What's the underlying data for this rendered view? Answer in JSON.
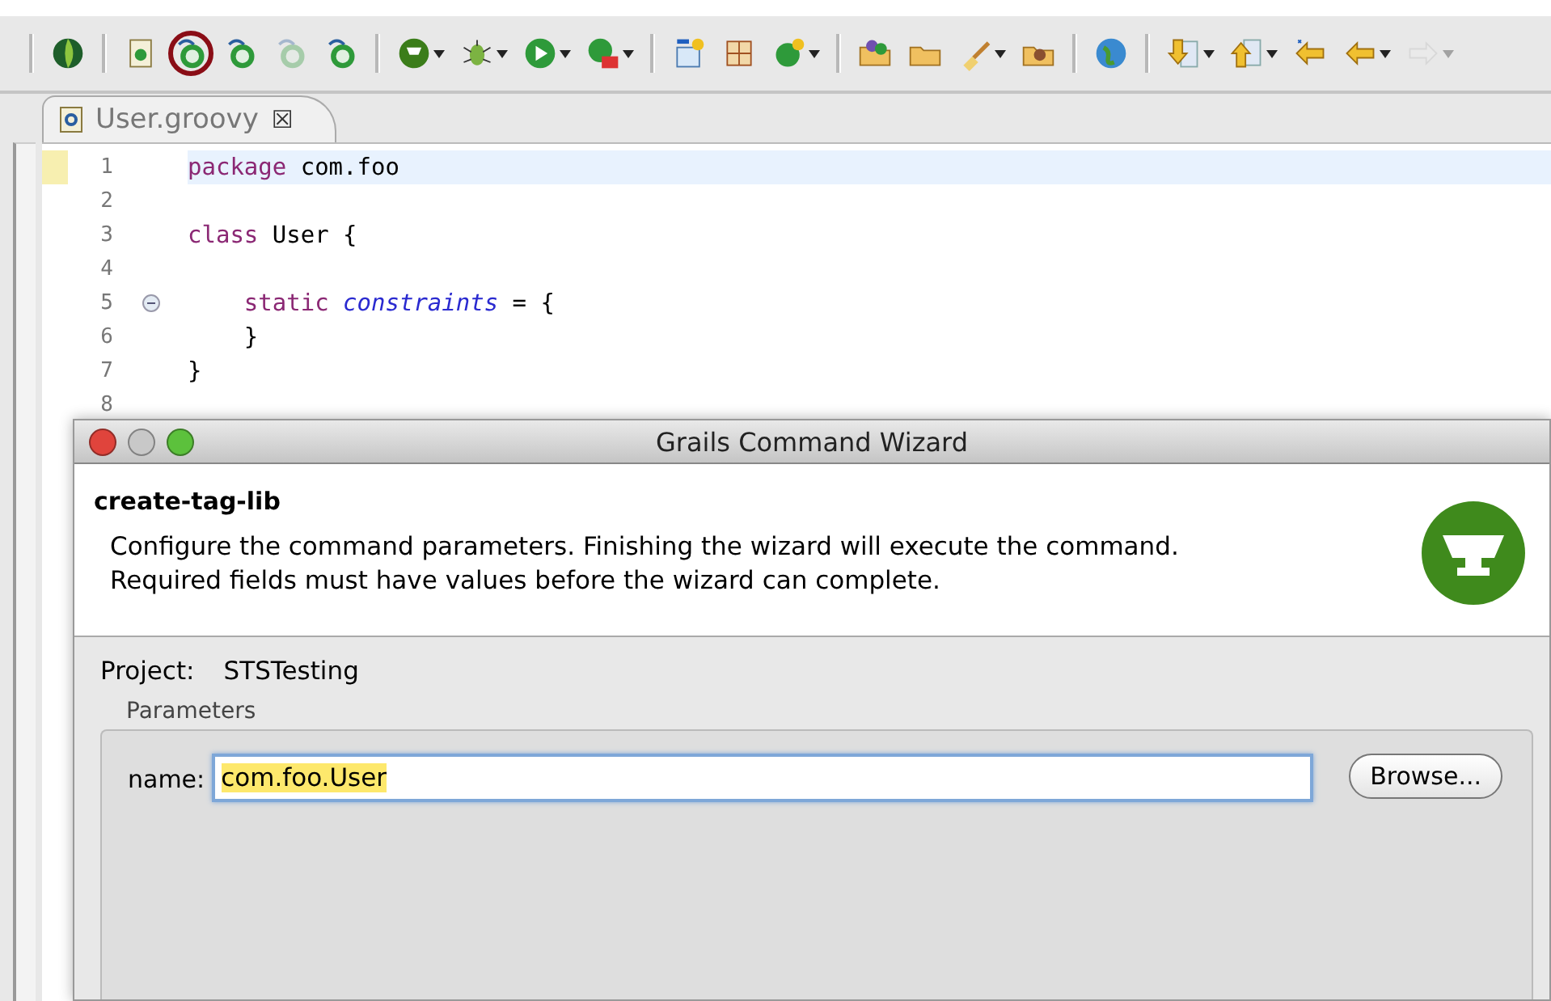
{
  "toolbar": [
    [
      {
        "dropdown": false,
        "circled": false,
        "disabled": false
      }
    ],
    [
      {
        "dropdown": false,
        "circled": false,
        "disabled": false
      },
      {
        "dropdown": false,
        "circled": true,
        "disabled": false
      },
      {
        "dropdown": false,
        "circled": false,
        "disabled": false
      },
      {
        "dropdown": false,
        "circled": false,
        "disabled": true
      },
      {
        "dropdown": false,
        "circled": false,
        "disabled": false
      }
    ],
    [
      {
        "dropdown": true,
        "circled": false,
        "disabled": false
      },
      {
        "dropdown": true,
        "circled": false,
        "disabled": false
      },
      {
        "dropdown": true,
        "circled": false,
        "disabled": false
      },
      {
        "dropdown": true,
        "circled": false,
        "disabled": false
      }
    ],
    [
      {
        "dropdown": false,
        "circled": false,
        "disabled": false
      },
      {
        "dropdown": false,
        "circled": false,
        "disabled": false
      },
      {
        "dropdown": true,
        "circled": false,
        "disabled": false
      }
    ],
    [
      {
        "dropdown": false,
        "circled": false,
        "disabled": false
      },
      {
        "dropdown": false,
        "circled": false,
        "disabled": false
      },
      {
        "dropdown": true,
        "circled": false,
        "disabled": false
      },
      {
        "dropdown": false,
        "circled": false,
        "disabled": false
      }
    ],
    [
      {
        "dropdown": false,
        "circled": false,
        "disabled": false
      }
    ],
    [
      {
        "dropdown": true,
        "circled": false,
        "disabled": false
      },
      {
        "dropdown": true,
        "circled": false,
        "disabled": false
      },
      {
        "dropdown": false,
        "circled": false,
        "disabled": false
      },
      {
        "dropdown": true,
        "circled": false,
        "disabled": false
      },
      {
        "dropdown": true,
        "circled": false,
        "disabled": true
      }
    ]
  ],
  "editor_tab": {
    "label": "User.groovy",
    "close": "☒",
    "selected": true
  },
  "code_lines": [
    {
      "number": "1",
      "current": true,
      "fold_marker": false,
      "tokens": [
        {
          "kind": "keyword",
          "text": "package"
        },
        {
          "kind": "plain",
          "text": " com.foo"
        }
      ]
    },
    {
      "number": "2",
      "current": false,
      "fold_marker": false
    },
    {
      "number": "3",
      "current": false,
      "fold_marker": false,
      "tokens": [
        {
          "kind": "keyword",
          "text": "class"
        },
        {
          "kind": "plain",
          "text": " User {"
        }
      ]
    },
    {
      "number": "4",
      "current": false,
      "fold_marker": false
    },
    {
      "number": "5",
      "current": false,
      "fold_marker": true,
      "tokens": [
        {
          "kind": "keyword",
          "text": "    static"
        },
        {
          "kind": "field",
          "text": " constraints"
        },
        {
          "kind": "plain",
          "text": " = {"
        }
      ]
    },
    {
      "number": "6",
      "current": false,
      "fold_marker": false,
      "tokens": [
        {
          "kind": "plain",
          "text": "    }"
        }
      ]
    },
    {
      "number": "7",
      "current": false,
      "fold_marker": false,
      "tokens": [
        {
          "kind": "plain",
          "text": "}"
        }
      ]
    },
    {
      "number": "8",
      "current": false,
      "fold_marker": false
    }
  ],
  "dialog": {
    "title": "Grails Command Wizard",
    "heading": "create-tag-lib",
    "description": [
      "Configure the command parameters. Finishing the wizard will execute the command.",
      "Required fields must have values before the wizard can complete."
    ],
    "project_label": "Project:",
    "project_value": "STSTesting",
    "group_title": "Parameters",
    "field_label": "name:",
    "field_value": "com.foo.User",
    "field_selected": true,
    "browse_button": "Browse..."
  }
}
